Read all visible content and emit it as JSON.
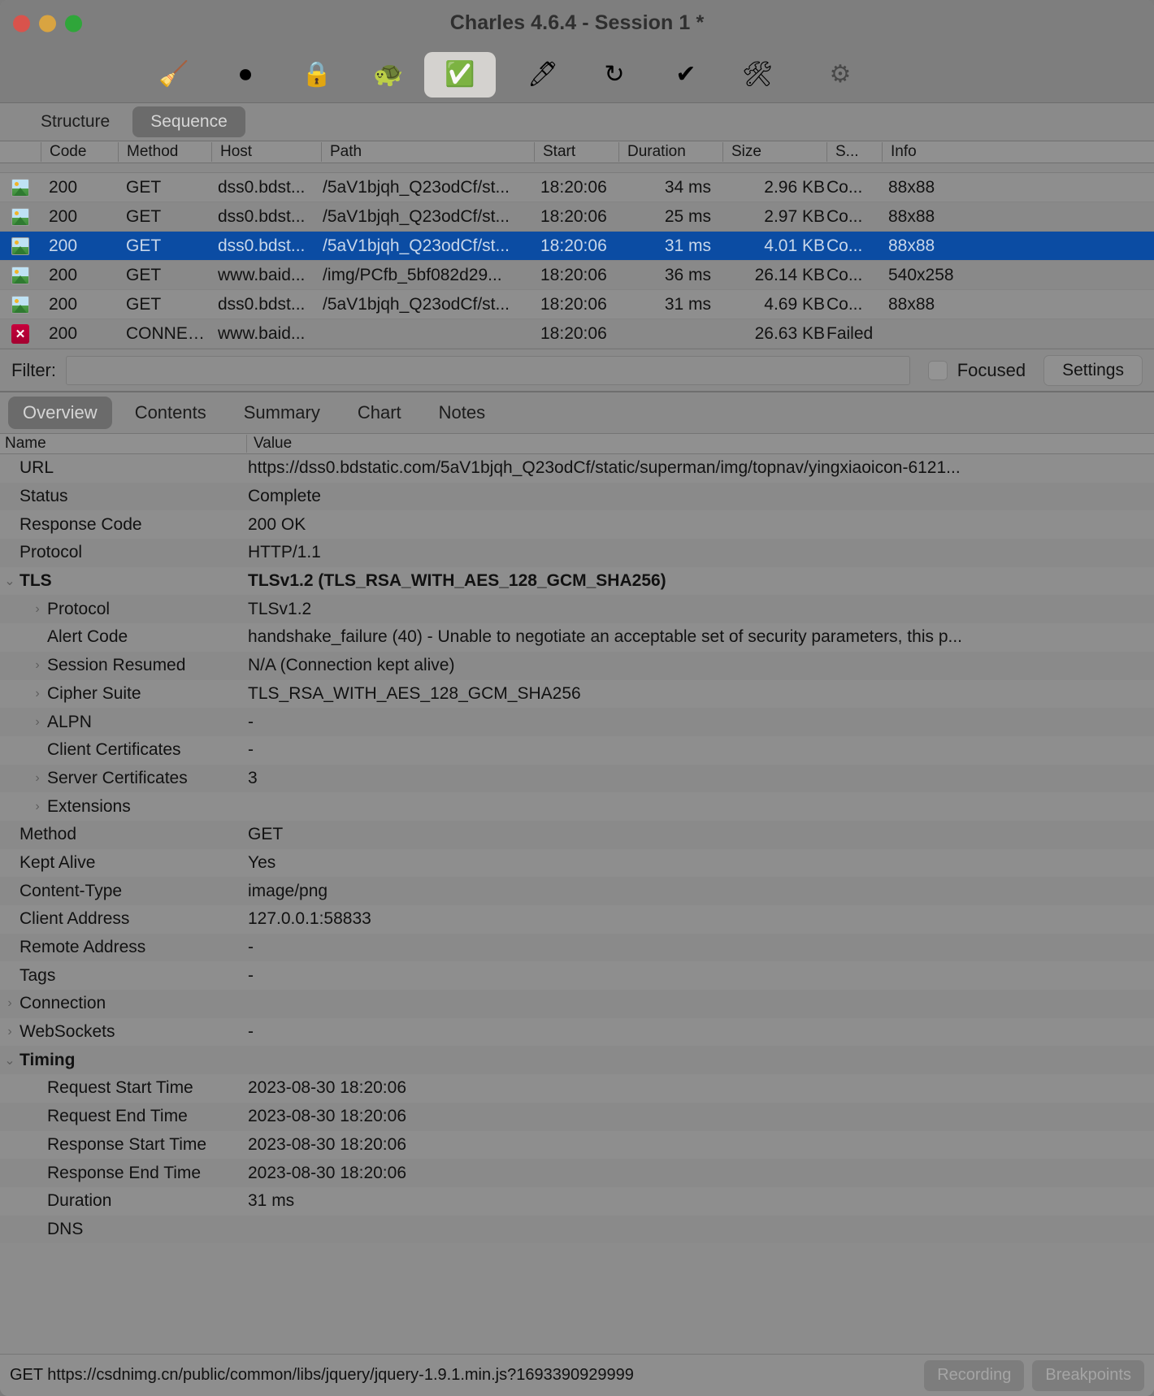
{
  "window": {
    "title": "Charles 4.6.4 - Session 1 *",
    "traffic_lights": [
      "close",
      "minimize",
      "zoom"
    ]
  },
  "toolbar": {
    "buttons": [
      {
        "name": "clear-session",
        "icon": "broom-icon",
        "glyph": "🧹",
        "active": false,
        "dim": false
      },
      {
        "name": "start-stop-recording",
        "icon": "record-icon",
        "glyph": "⏺",
        "active": false,
        "dim": false
      },
      {
        "name": "ssl-proxying",
        "icon": "lock-icon",
        "glyph": "🔒",
        "active": false,
        "dim": false
      },
      {
        "name": "throttle",
        "icon": "turtle-icon",
        "glyph": "🐢",
        "active": false,
        "dim": false
      },
      {
        "name": "breakpoints",
        "icon": "stop-check-octagon-icon",
        "glyph": "✅",
        "active": true,
        "dim": false
      },
      {
        "name": "compose",
        "icon": "pen-icon",
        "glyph": "🖊",
        "active": false,
        "dim": false
      },
      {
        "name": "repeat",
        "icon": "refresh-icon",
        "glyph": "↻",
        "active": false,
        "dim": false
      },
      {
        "name": "validate",
        "icon": "checkmark-icon",
        "glyph": "✔",
        "active": false,
        "dim": false
      },
      {
        "name": "tools",
        "icon": "hammer-wrench-icon",
        "glyph": "🛠",
        "active": false,
        "dim": false
      },
      {
        "name": "settings",
        "icon": "gear-icon",
        "glyph": "⚙",
        "active": false,
        "dim": true
      }
    ]
  },
  "view_mode": {
    "structure_label": "Structure",
    "sequence_label": "Sequence",
    "selected": "Sequence"
  },
  "session_list": {
    "columns": [
      "",
      "Code",
      "Method",
      "Host",
      "Path",
      "Start",
      "Duration",
      "Size",
      "S...",
      "Info"
    ],
    "rows": [
      {
        "icon": "image-icon",
        "code": "200",
        "method": "GET",
        "host": "dss0.bdst...",
        "path": "/5aV1bjqh_Q23odCf/st...",
        "start": "18:20:06",
        "duration": "34 ms",
        "size": "2.96 KB",
        "status": "Co...",
        "info": "88x88",
        "selected": false
      },
      {
        "icon": "image-icon",
        "code": "200",
        "method": "GET",
        "host": "dss0.bdst...",
        "path": "/5aV1bjqh_Q23odCf/st...",
        "start": "18:20:06",
        "duration": "25 ms",
        "size": "2.97 KB",
        "status": "Co...",
        "info": "88x88",
        "selected": false
      },
      {
        "icon": "image-icon",
        "code": "200",
        "method": "GET",
        "host": "dss0.bdst...",
        "path": "/5aV1bjqh_Q23odCf/st...",
        "start": "18:20:06",
        "duration": "31 ms",
        "size": "4.01 KB",
        "status": "Co...",
        "info": "88x88",
        "selected": true
      },
      {
        "icon": "image-icon",
        "code": "200",
        "method": "GET",
        "host": "www.baid...",
        "path": "/img/PCfb_5bf082d29...",
        "start": "18:20:06",
        "duration": "36 ms",
        "size": "26.14 KB",
        "status": "Co...",
        "info": "540x258",
        "selected": false
      },
      {
        "icon": "image-icon",
        "code": "200",
        "method": "GET",
        "host": "dss0.bdst...",
        "path": "/5aV1bjqh_Q23odCf/st...",
        "start": "18:20:06",
        "duration": "31 ms",
        "size": "4.69 KB",
        "status": "Co...",
        "info": "88x88",
        "selected": false
      },
      {
        "icon": "error-icon",
        "code": "200",
        "method": "CONNECT",
        "host": "www.baid...",
        "path": "",
        "start": "18:20:06",
        "duration": "",
        "size": "26.63 KB",
        "status": "Failed",
        "info": "",
        "selected": false
      }
    ]
  },
  "filter": {
    "label": "Filter:",
    "value": "",
    "placeholder": "",
    "focused_label": "Focused",
    "focused_checked": false,
    "settings_label": "Settings"
  },
  "detail_tabs": {
    "items": [
      "Overview",
      "Contents",
      "Summary",
      "Chart",
      "Notes"
    ],
    "selected": "Overview"
  },
  "detail_table": {
    "columns": {
      "name": "Name",
      "value": "Value"
    },
    "rows": [
      {
        "name": "URL",
        "value": "https://dss0.bdstatic.com/5aV1bjqh_Q23odCf/static/superman/img/topnav/yingxiaoicon-6121...",
        "indent": 0,
        "twisty": "",
        "bold": false
      },
      {
        "name": "Status",
        "value": "Complete",
        "indent": 0,
        "twisty": "",
        "bold": false
      },
      {
        "name": "Response Code",
        "value": "200 OK",
        "indent": 0,
        "twisty": "",
        "bold": false
      },
      {
        "name": "Protocol",
        "value": "HTTP/1.1",
        "indent": 0,
        "twisty": "",
        "bold": false
      },
      {
        "name": "TLS",
        "value": "TLSv1.2 (TLS_RSA_WITH_AES_128_GCM_SHA256)",
        "indent": 0,
        "twisty": "expanded",
        "bold": true
      },
      {
        "name": "Protocol",
        "value": "TLSv1.2",
        "indent": 1,
        "twisty": "collapsed",
        "bold": false
      },
      {
        "name": "Alert Code",
        "value": "handshake_failure (40) - Unable to negotiate an acceptable set of security parameters, this p...",
        "indent": 1,
        "twisty": "",
        "bold": false
      },
      {
        "name": "Session Resumed",
        "value": "N/A (Connection kept alive)",
        "indent": 1,
        "twisty": "collapsed",
        "bold": false
      },
      {
        "name": "Cipher Suite",
        "value": "TLS_RSA_WITH_AES_128_GCM_SHA256",
        "indent": 1,
        "twisty": "collapsed",
        "bold": false
      },
      {
        "name": "ALPN",
        "value": "-",
        "indent": 1,
        "twisty": "collapsed",
        "bold": false
      },
      {
        "name": "Client Certificates",
        "value": "-",
        "indent": 1,
        "twisty": "",
        "bold": false
      },
      {
        "name": "Server Certificates",
        "value": "3",
        "indent": 1,
        "twisty": "collapsed",
        "bold": false
      },
      {
        "name": "Extensions",
        "value": "",
        "indent": 1,
        "twisty": "collapsed",
        "bold": false
      },
      {
        "name": "Method",
        "value": "GET",
        "indent": 0,
        "twisty": "",
        "bold": false
      },
      {
        "name": "Kept Alive",
        "value": "Yes",
        "indent": 0,
        "twisty": "",
        "bold": false
      },
      {
        "name": "Content-Type",
        "value": "image/png",
        "indent": 0,
        "twisty": "",
        "bold": false
      },
      {
        "name": "Client Address",
        "value": "127.0.0.1:58833",
        "indent": 0,
        "twisty": "",
        "bold": false
      },
      {
        "name": "Remote Address",
        "value": "-",
        "indent": 0,
        "twisty": "",
        "bold": false
      },
      {
        "name": "Tags",
        "value": "-",
        "indent": 0,
        "twisty": "",
        "bold": false
      },
      {
        "name": "Connection",
        "value": "",
        "indent": 0,
        "twisty": "collapsed",
        "bold": false
      },
      {
        "name": "WebSockets",
        "value": "-",
        "indent": 0,
        "twisty": "collapsed",
        "bold": false
      },
      {
        "name": "Timing",
        "value": "",
        "indent": 0,
        "twisty": "expanded",
        "bold": true
      },
      {
        "name": "Request Start Time",
        "value": "2023-08-30 18:20:06",
        "indent": 1,
        "twisty": "",
        "bold": false
      },
      {
        "name": "Request End Time",
        "value": "2023-08-30 18:20:06",
        "indent": 1,
        "twisty": "",
        "bold": false
      },
      {
        "name": "Response Start Time",
        "value": "2023-08-30 18:20:06",
        "indent": 1,
        "twisty": "",
        "bold": false
      },
      {
        "name": "Response End Time",
        "value": "2023-08-30 18:20:06",
        "indent": 1,
        "twisty": "",
        "bold": false
      },
      {
        "name": "Duration",
        "value": "31 ms",
        "indent": 1,
        "twisty": "",
        "bold": false
      },
      {
        "name": "DNS",
        "value": "",
        "indent": 1,
        "twisty": "",
        "bold": false
      }
    ]
  },
  "status_bar": {
    "text": "GET https://csdnimg.cn/public/common/libs/jquery/jquery-1.9.1.min.js?1693390929999",
    "recording_label": "Recording",
    "breakpoints_label": "Breakpoints"
  },
  "colors": {
    "selection_blue": "#0b4ca3",
    "error_red": "#c8003c",
    "window_gray": "#8a8a8a"
  }
}
